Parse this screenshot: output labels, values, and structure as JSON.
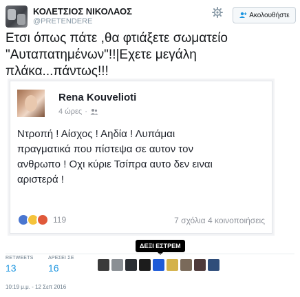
{
  "author": {
    "name": "ΚΟΛΕΤΣΙΟΣ ΝΙΚΟΛΑΟΣ",
    "handle": "@PRETENDERE"
  },
  "follow_button": {
    "label": "Ακολουθήστε",
    "icon": "add-user-icon"
  },
  "settings_icon": "gear-icon",
  "tweet": {
    "lines": [
      "Ετσι όπως πάτε ,θα φτιάξετε σωματείο",
      "\"Αυταπατημένων\"!!|Εχετε μεγάλη",
      "πλάκα...πάντως!!!"
    ]
  },
  "facebook_post": {
    "author": "Rena Kouvelioti",
    "time": "4 ώρες",
    "privacy_icon": "friends-icon",
    "lines": [
      "Ντροπή ! Αίσχος ! Αηδία ! Λυπάμαι",
      "πραγματικά που πίστεψα σε αυτον τον",
      "ανθρωπο ! Οχι κύριε Τσίπρα αυτο δεν ειναι",
      "αριστερά !"
    ],
    "reactions": [
      "like",
      "wow",
      "angry"
    ],
    "reaction_count": "119",
    "comments": "7 σχόλια",
    "shares": "4 κοινοποιήσεις",
    "colors": {
      "like": "#4a76d0",
      "wow": "#f5c33b",
      "angry": "#e0593a"
    }
  },
  "tooltip": "ΔΕΞΙ ΕΣΤΡΕΜ",
  "stats": {
    "retweets_label": "RETWEETS",
    "retweets": "13",
    "likes_label": "ΑΡΕΣΕΙ ΣΕ",
    "likes": "16"
  },
  "likers": [
    {
      "name": "liker-1",
      "color": "#3a3a3a"
    },
    {
      "name": "liker-2",
      "color": "#8a8f94"
    },
    {
      "name": "liker-3",
      "color": "#2a2e33"
    },
    {
      "name": "liker-4",
      "color": "#1c1c1c"
    },
    {
      "name": "liker-5",
      "color": "#1e5bd8"
    },
    {
      "name": "liker-6",
      "color": "#d4b24a"
    },
    {
      "name": "liker-7",
      "color": "#7a6a5a"
    },
    {
      "name": "liker-8",
      "color": "#4e3a3a"
    },
    {
      "name": "liker-9",
      "color": "#2f4d7a"
    }
  ],
  "timestamp": "10:19 μ.μ. - 12 Σεπ 2016",
  "accent_color": "#1b95e0"
}
